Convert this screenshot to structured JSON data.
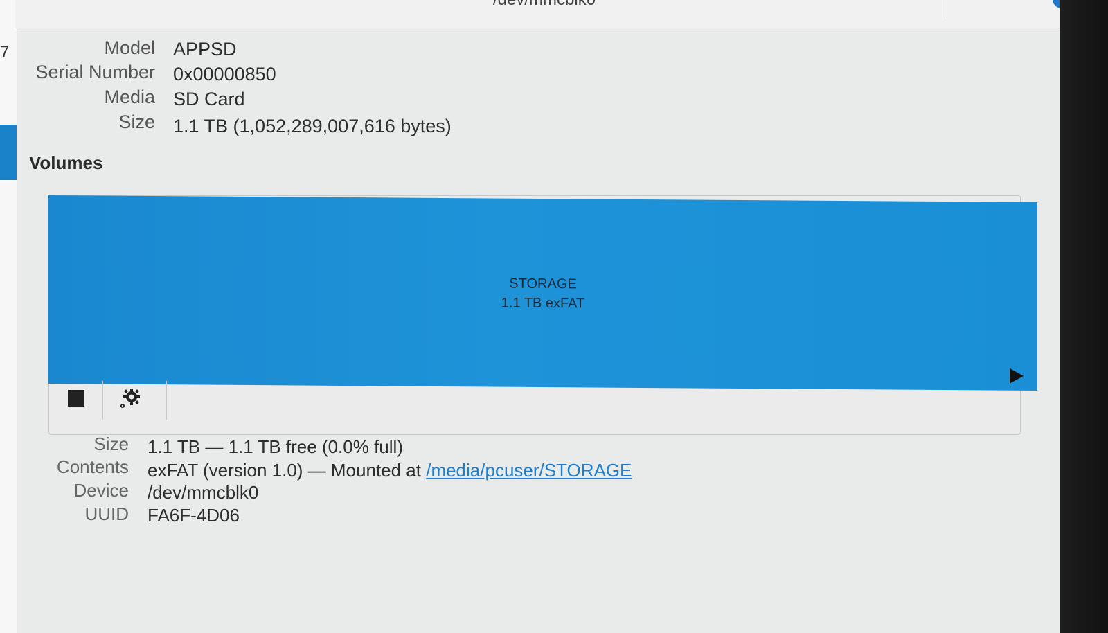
{
  "header": {
    "title": "/dev/mmcblk0"
  },
  "sidebar": {
    "partial_text": "7"
  },
  "drive": {
    "model_label": "Model",
    "model_value": "APPSD",
    "serial_label": "Serial Number",
    "serial_value": "0x00000850",
    "media_label": "Media",
    "media_value": "SD Card",
    "size_label": "Size",
    "size_value": "1.1 TB (1,052,289,007,616 bytes)"
  },
  "volumes": {
    "heading": "Volumes",
    "partition": {
      "name": "STORAGE",
      "description": "1.1 TB exFAT",
      "color": "#1a8fd6"
    },
    "toolbar": {
      "stop_icon": "stop-icon",
      "settings_icon": "gear-icon"
    }
  },
  "details": {
    "size_label": "Size",
    "size_value": "1.1 TB — 1.1 TB free (0.0% full)",
    "contents_label": "Contents",
    "contents_value": "exFAT (version 1.0) — Mounted at ",
    "mount_path": "/media/pcuser/STORAGE",
    "device_label": "Device",
    "device_value": "/dev/mmcblk0",
    "uuid_label": "UUID",
    "uuid_value": "FA6F-4D06"
  }
}
